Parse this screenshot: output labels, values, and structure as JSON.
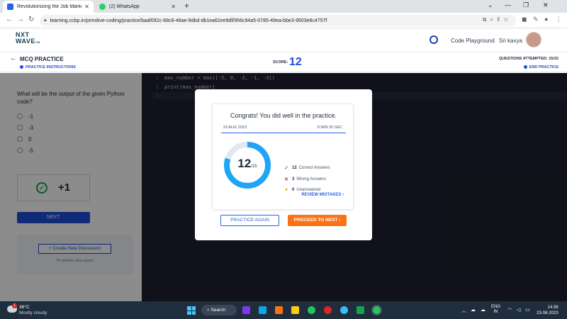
{
  "browser": {
    "tabs": [
      {
        "title": "Revolutionizing the Job Market |",
        "active": true,
        "favicon_color": "#2563eb"
      },
      {
        "title": "(2) WhatsApp",
        "active": false,
        "favicon_color": "#25d366"
      }
    ],
    "new_tab_glyph": "+",
    "url": "learning.ccbp.in/primitive-coding/practice/baaf092c-68c8-46ae-9dbd-db1ea62ee9df/956c94a5-0785-49ea-bbe3-9503e8c4757f",
    "window_controls": [
      "⌄",
      "—",
      "❐",
      "✕"
    ]
  },
  "app_header": {
    "logo_line1": "NXT",
    "logo_line2": "WAVE",
    "logo_tm": "TM",
    "code_playground": "Code Playground",
    "user_name": "Sri kavya"
  },
  "practice_bar": {
    "title": "MCQ PRACTICE",
    "instructions_link": "PRACTICE INSTRUCTIONS",
    "score_label": "SCORE:",
    "score_value": "12",
    "questions_attempted": "QUESTIONS ATTEMPTED: 15/15",
    "end_practice": "END PRACTICE"
  },
  "question_panel": {
    "question": "What will be the output of the given Python code?",
    "options": [
      "-1",
      "-3",
      "0",
      "-5"
    ],
    "result_points": "+1",
    "next_label": "NEXT",
    "create_discussion": "+ Create New Discussion",
    "resolve_text": "To resolve your query"
  },
  "editor": {
    "lines": [
      {
        "num": "1",
        "code": "max_number = max([-5, 0, -2, -1, -3])"
      },
      {
        "num": "2",
        "code": "print(max_number)"
      },
      {
        "num": "3",
        "code": ""
      }
    ]
  },
  "modal": {
    "heading": "Congrats! You did well in the practice.",
    "date": "23 AUG 2023",
    "duration": "8 MIN 30 SEC",
    "score": "12",
    "total": "/15",
    "score_fraction": 0.8,
    "stats": [
      {
        "count": "12",
        "label": "Correct Answers",
        "icon": "check-icon",
        "color": "#16a34a"
      },
      {
        "count": "3",
        "label": "Wrong Answers",
        "icon": "cross-icon",
        "color": "#dc2626"
      },
      {
        "count": "0",
        "label": "Unanswered",
        "icon": "dot-icon",
        "color": "#eab308"
      }
    ],
    "review_mistakes": "REVIEW MISTAKES",
    "practice_again": "PRACTICE AGAIN",
    "proceed_next": "PROCEED TO NEXT"
  },
  "taskbar": {
    "weather_badge": "1",
    "temperature": "36°C",
    "weather": "Mostly cloudy",
    "search": "Search",
    "language_line1": "ENG",
    "language_line2": "IN",
    "time": "14:36",
    "date": "23-08-2023"
  },
  "colors": {
    "accent_blue": "#1d4ed8",
    "orange": "#f97316",
    "ring_blue": "#1ea5f5",
    "editor_bg": "#1e2030"
  }
}
